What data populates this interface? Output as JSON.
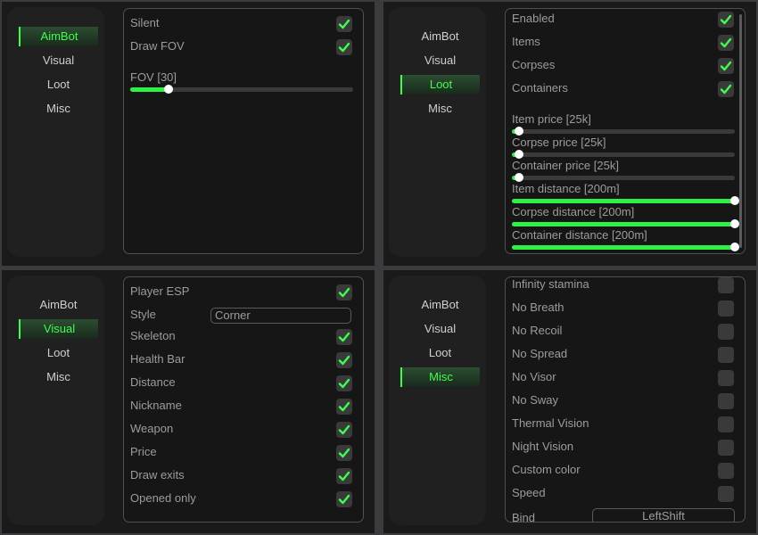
{
  "nav": [
    "AimBot",
    "Visual",
    "Loot",
    "Misc"
  ],
  "accent": "#3cff4c",
  "aimbot": {
    "active_tab": "AimBot",
    "toggles": [
      {
        "label": "Silent",
        "checked": true
      },
      {
        "label": "Draw FOV",
        "checked": true
      }
    ],
    "slider": {
      "label": "FOV [30]",
      "fraction": 0.17
    }
  },
  "loot": {
    "active_tab": "Loot",
    "toggles": [
      {
        "label": "Enabled",
        "checked": true
      },
      {
        "label": "Items",
        "checked": true
      },
      {
        "label": "Corpses",
        "checked": true
      },
      {
        "label": "Containers",
        "checked": true
      }
    ],
    "sliders": [
      {
        "label": "Item price [25k]",
        "fraction": 0.03
      },
      {
        "label": "Corpse price [25k]",
        "fraction": 0.03
      },
      {
        "label": "Container price [25k]",
        "fraction": 0.03
      },
      {
        "label": "Item distance [200m]",
        "fraction": 1.0
      },
      {
        "label": "Corpse distance [200m]",
        "fraction": 1.0
      },
      {
        "label": "Container distance [200m]",
        "fraction": 1.0
      }
    ]
  },
  "visual": {
    "active_tab": "Visual",
    "player_esp": {
      "label": "Player ESP",
      "checked": true
    },
    "style": {
      "label": "Style",
      "value": "Corner"
    },
    "toggles": [
      {
        "label": "Skeleton",
        "checked": true
      },
      {
        "label": "Health Bar",
        "checked": true
      },
      {
        "label": "Distance",
        "checked": true
      },
      {
        "label": "Nickname",
        "checked": true
      },
      {
        "label": "Weapon",
        "checked": true
      },
      {
        "label": "Price",
        "checked": true
      },
      {
        "label": "Draw exits",
        "checked": true
      },
      {
        "label": "Opened only",
        "checked": true
      }
    ]
  },
  "misc": {
    "active_tab": "Misc",
    "toggles": [
      {
        "label": "Infinity stamina",
        "checked": false
      },
      {
        "label": "No Breath",
        "checked": false
      },
      {
        "label": "No Recoil",
        "checked": false
      },
      {
        "label": "No Spread",
        "checked": false
      },
      {
        "label": "No Visor",
        "checked": false
      },
      {
        "label": "No Sway",
        "checked": false
      },
      {
        "label": "Thermal Vision",
        "checked": false
      },
      {
        "label": "Night Vision",
        "checked": false
      },
      {
        "label": "Custom color",
        "checked": false
      },
      {
        "label": "Speed",
        "checked": false
      }
    ],
    "bind": {
      "label": "Bind",
      "value": "LeftShift"
    }
  }
}
